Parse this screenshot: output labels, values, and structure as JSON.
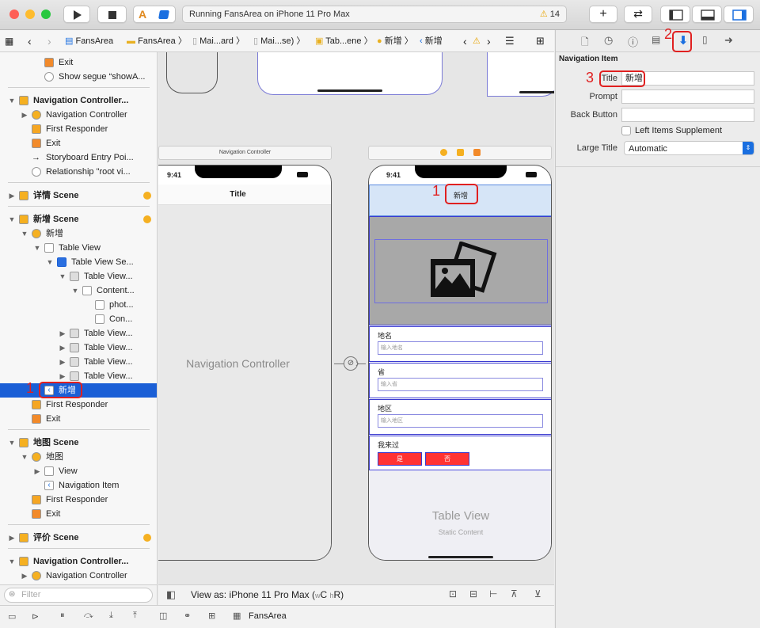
{
  "toolbar": {
    "scheme_app": "A",
    "status": "Running FansArea on iPhone 11 Pro Max",
    "warnings": "14",
    "colors": {
      "close": "#fe5f57",
      "minimize": "#febc2e",
      "zoom": "#28c840",
      "accent": "#1a6fe0",
      "annotation": "#e02020"
    }
  },
  "breadcrumbs": [
    "FansArea",
    "FansArea",
    "Mai...ard",
    "Mai...se)",
    "Tab...ene",
    "新增",
    "新增"
  ],
  "outline": {
    "rows": [
      {
        "label": "Exit",
        "indent": 2,
        "icon": "exit-icon"
      },
      {
        "label": "Show segue “showA...",
        "indent": 2,
        "icon": "segue-icon"
      },
      {
        "label": "Navigation Controller...",
        "indent": 0,
        "icon": "scene-icon",
        "bold": true
      },
      {
        "label": "Navigation Controller",
        "indent": 1,
        "icon": "nav-controller-icon"
      },
      {
        "label": "First Responder",
        "indent": 1,
        "icon": "first-responder-icon"
      },
      {
        "label": "Exit",
        "indent": 1,
        "icon": "exit-icon"
      },
      {
        "label": "Storyboard Entry Poi...",
        "indent": 1,
        "icon": "entry-arrow-icon"
      },
      {
        "label": "Relationship \"root vi...",
        "indent": 1,
        "icon": "relationship-icon"
      },
      {
        "label": "详情 Scene",
        "indent": 0,
        "icon": "scene-icon",
        "bold": true
      },
      {
        "label": "新增 Scene",
        "indent": 0,
        "icon": "scene-icon",
        "bold": true
      },
      {
        "label": "新增",
        "indent": 1,
        "icon": "view-controller-icon"
      },
      {
        "label": "Table View",
        "indent": 2,
        "icon": "table-view-icon"
      },
      {
        "label": "Table View Se...",
        "indent": 3,
        "icon": "table-section-icon"
      },
      {
        "label": "Table View...",
        "indent": 4,
        "icon": "table-cell-icon"
      },
      {
        "label": "Content...",
        "indent": 5,
        "icon": "content-view-icon"
      },
      {
        "label": "phot...",
        "indent": 6,
        "icon": "image-view-icon"
      },
      {
        "label": "Con...",
        "indent": 6,
        "icon": "constraints-icon"
      },
      {
        "label": "Table View...",
        "indent": 4,
        "icon": "table-cell-icon"
      },
      {
        "label": "Table View...",
        "indent": 4,
        "icon": "table-cell-icon"
      },
      {
        "label": "Table View...",
        "indent": 4,
        "icon": "table-cell-icon"
      },
      {
        "label": "Table View...",
        "indent": 4,
        "icon": "table-cell-icon"
      },
      {
        "label": "新增",
        "indent": 2,
        "icon": "navigation-item-icon",
        "selected": true
      },
      {
        "label": "First Responder",
        "indent": 1,
        "icon": "first-responder-icon"
      },
      {
        "label": "Exit",
        "indent": 1,
        "icon": "exit-icon"
      },
      {
        "label": "地图 Scene",
        "indent": 0,
        "icon": "scene-icon",
        "bold": true
      },
      {
        "label": "地图",
        "indent": 1,
        "icon": "view-controller-icon"
      },
      {
        "label": "View",
        "indent": 2,
        "icon": "view-icon"
      },
      {
        "label": "Navigation Item",
        "indent": 2,
        "icon": "navigation-item-icon"
      },
      {
        "label": "First Responder",
        "indent": 1,
        "icon": "first-responder-icon"
      },
      {
        "label": "Exit",
        "indent": 1,
        "icon": "exit-icon"
      },
      {
        "label": "评价 Scene",
        "indent": 0,
        "icon": "scene-icon",
        "bold": true
      },
      {
        "label": "Navigation Controller...",
        "indent": 0,
        "icon": "scene-icon",
        "bold": true
      },
      {
        "label": "Navigation Controller",
        "indent": 1,
        "icon": "nav-controller-icon"
      }
    ],
    "filter_placeholder": "Filter"
  },
  "canvas": {
    "nav_controller_label": "Navigation Controller",
    "left_phone": {
      "time": "9:41",
      "title": "Title",
      "placeholder": "Navigation Controller"
    },
    "right_phone": {
      "time": "9:41",
      "title": "新增",
      "fields": [
        {
          "label": "地名",
          "placeholder": "输入地名"
        },
        {
          "label": "省",
          "placeholder": "输入省"
        },
        {
          "label": "地区",
          "placeholder": "输入地区"
        }
      ],
      "visited_label": "我来过",
      "yes": "是",
      "no": "否",
      "table_view": "Table View",
      "static_content": "Static Content"
    },
    "view_as": "View as: iPhone 11 Pro Max (",
    "view_as_w": "w",
    "view_as_c": "C",
    "view_as_h": "h",
    "view_as_r": "R)"
  },
  "inspector": {
    "section": "Navigation Item",
    "title_label": "Title",
    "title_value": "新增",
    "prompt_label": "Prompt",
    "prompt_value": "",
    "back_label": "Back Button",
    "back_value": "",
    "left_items": "Left Items Supplement",
    "large_title_label": "Large Title",
    "large_title_value": "Automatic"
  },
  "annotations": {
    "one": "1",
    "two": "2",
    "three": "3"
  },
  "debugbar": {
    "target": "FansArea"
  }
}
